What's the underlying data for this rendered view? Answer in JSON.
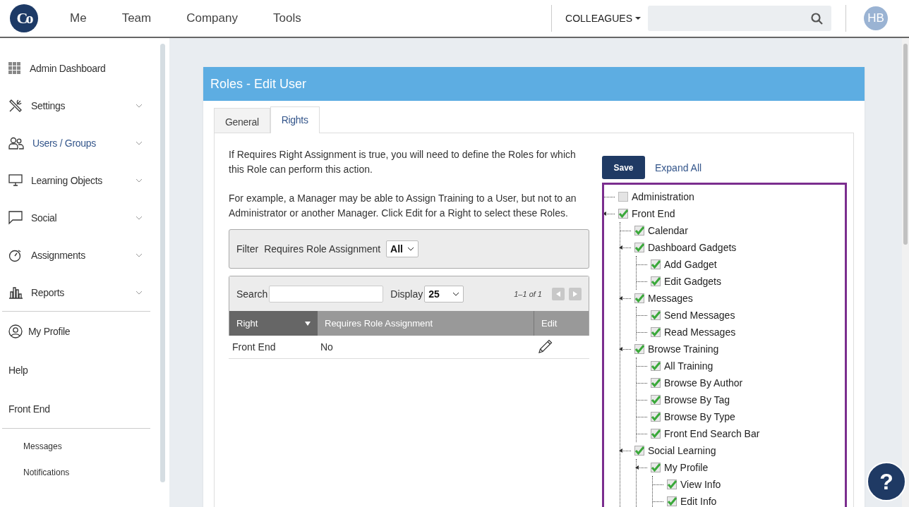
{
  "header": {
    "logo": "Co",
    "nav": [
      {
        "label": "Me"
      },
      {
        "label": "Team"
      },
      {
        "label": "Company"
      },
      {
        "label": "Tools"
      }
    ],
    "colleagues": "COLLEAGUES",
    "avatar": "HB"
  },
  "sidebar": {
    "items": [
      {
        "label": "Admin Dashboard",
        "has_menu": false,
        "selected": false
      },
      {
        "label": "Settings",
        "has_menu": true,
        "selected": false
      },
      {
        "label": "Users / Groups",
        "has_menu": true,
        "selected": true
      },
      {
        "label": "Learning Objects",
        "has_menu": true,
        "selected": false
      },
      {
        "label": "Social",
        "has_menu": true,
        "selected": false
      },
      {
        "label": "Assignments",
        "has_menu": true,
        "selected": false
      },
      {
        "label": "Reports",
        "has_menu": true,
        "selected": false
      }
    ],
    "links": [
      {
        "label": "My Profile"
      },
      {
        "label": "Help"
      },
      {
        "label": "Front End"
      }
    ],
    "sub_links": [
      {
        "label": "Messages"
      },
      {
        "label": "Notifications"
      }
    ]
  },
  "card": {
    "title": "Roles - Edit User",
    "tabs": [
      {
        "label": "General",
        "selected": false
      },
      {
        "label": "Rights",
        "selected": true
      }
    ],
    "paragraphs": [
      "If Requires Right Assignment is true, you will need to define the Roles for which this Role can perform this action.",
      "For example, a Manager may be able to Assign Training to a User, but not to an Administrator or another Manager. Click Edit for a Right to select these Roles."
    ],
    "filter": {
      "label": "Filter",
      "field_label": "Requires Role Assignment",
      "value": "All"
    },
    "table": {
      "search_label": "Search",
      "display_label": "Display",
      "display_value": "25",
      "pager": "1–1 of 1",
      "columns": [
        {
          "label": "Right",
          "sorted": true
        },
        {
          "label": "Requires Role Assignment",
          "sorted": false
        },
        {
          "label": "Edit",
          "sorted": false
        }
      ],
      "rows": [
        {
          "right": "Front End",
          "requires": "No"
        }
      ]
    },
    "save": "Save",
    "expand_all": "Expand All",
    "help_button": "?",
    "tree": [
      {
        "label": "Administration",
        "checked": false,
        "expanded": false
      },
      {
        "label": "Front End",
        "checked": true,
        "expanded": true,
        "children": [
          {
            "label": "Calendar",
            "checked": true,
            "expanded": false
          },
          {
            "label": "Dashboard Gadgets",
            "checked": true,
            "expanded": true,
            "children": [
              {
                "label": "Add Gadget",
                "checked": true,
                "expanded": false
              },
              {
                "label": "Edit Gadgets",
                "checked": true,
                "expanded": false
              }
            ]
          },
          {
            "label": "Messages",
            "checked": true,
            "expanded": true,
            "children": [
              {
                "label": "Send Messages",
                "checked": true,
                "expanded": false
              },
              {
                "label": "Read Messages",
                "checked": true,
                "expanded": false
              }
            ]
          },
          {
            "label": "Browse Training",
            "checked": true,
            "expanded": true,
            "children": [
              {
                "label": "All Training",
                "checked": true,
                "expanded": false
              },
              {
                "label": "Browse By Author",
                "checked": true,
                "expanded": false
              },
              {
                "label": "Browse By Tag",
                "checked": true,
                "expanded": false
              },
              {
                "label": "Browse By Type",
                "checked": true,
                "expanded": false
              },
              {
                "label": "Front End Search Bar",
                "checked": true,
                "expanded": false
              }
            ]
          },
          {
            "label": "Social Learning",
            "checked": true,
            "expanded": true,
            "children": [
              {
                "label": "My Profile",
                "checked": true,
                "expanded": true,
                "children": [
                  {
                    "label": "View Info",
                    "checked": true,
                    "expanded": false
                  },
                  {
                    "label": "Edit Info",
                    "checked": true,
                    "expanded": false
                  }
                ]
              }
            ]
          }
        ]
      }
    ]
  }
}
